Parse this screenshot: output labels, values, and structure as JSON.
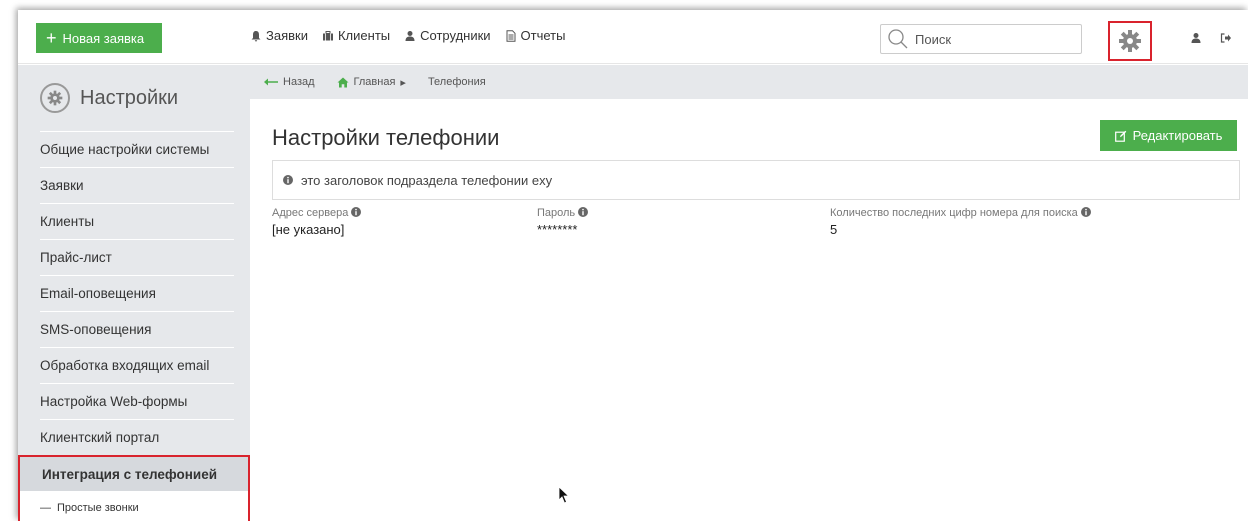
{
  "topbar": {
    "new_request_label": "Новая заявка",
    "nav": [
      {
        "label": "Заявки",
        "icon": "bell-icon"
      },
      {
        "label": "Клиенты",
        "icon": "briefcase-icon"
      },
      {
        "label": "Сотрудники",
        "icon": "user-icon"
      },
      {
        "label": "Отчеты",
        "icon": "document-icon"
      }
    ],
    "search_placeholder": "Поиск"
  },
  "sidebar": {
    "title": "Настройки",
    "items": [
      {
        "label": "Общие настройки системы"
      },
      {
        "label": "Заявки"
      },
      {
        "label": "Клиенты"
      },
      {
        "label": "Прайс-лист"
      },
      {
        "label": "Email-оповещения"
      },
      {
        "label": "SMS-оповещения"
      },
      {
        "label": "Обработка входящих email"
      },
      {
        "label": "Настройка Web-формы"
      },
      {
        "label": "Клиентский портал"
      },
      {
        "label": "Интеграция с телефонией"
      }
    ],
    "sub_item": "Простые звонки"
  },
  "breadcrumb": {
    "back": "Назад",
    "home": "Главная",
    "current": "Телефония"
  },
  "main": {
    "title": "Настройки телефонии",
    "edit_label": "Редактировать",
    "info_text": "это заголовок подраздела телефонии exy",
    "fields": [
      {
        "label": "Адрес сервера",
        "value": "[не указано]"
      },
      {
        "label": "Пароль",
        "value": "********"
      },
      {
        "label": "Количество последних цифр номера для поиска",
        "value": "5"
      }
    ]
  },
  "colors": {
    "accent_green": "#4cae4c",
    "highlight_red": "#d9232d",
    "sidebar_bg": "#e6e8eb"
  }
}
